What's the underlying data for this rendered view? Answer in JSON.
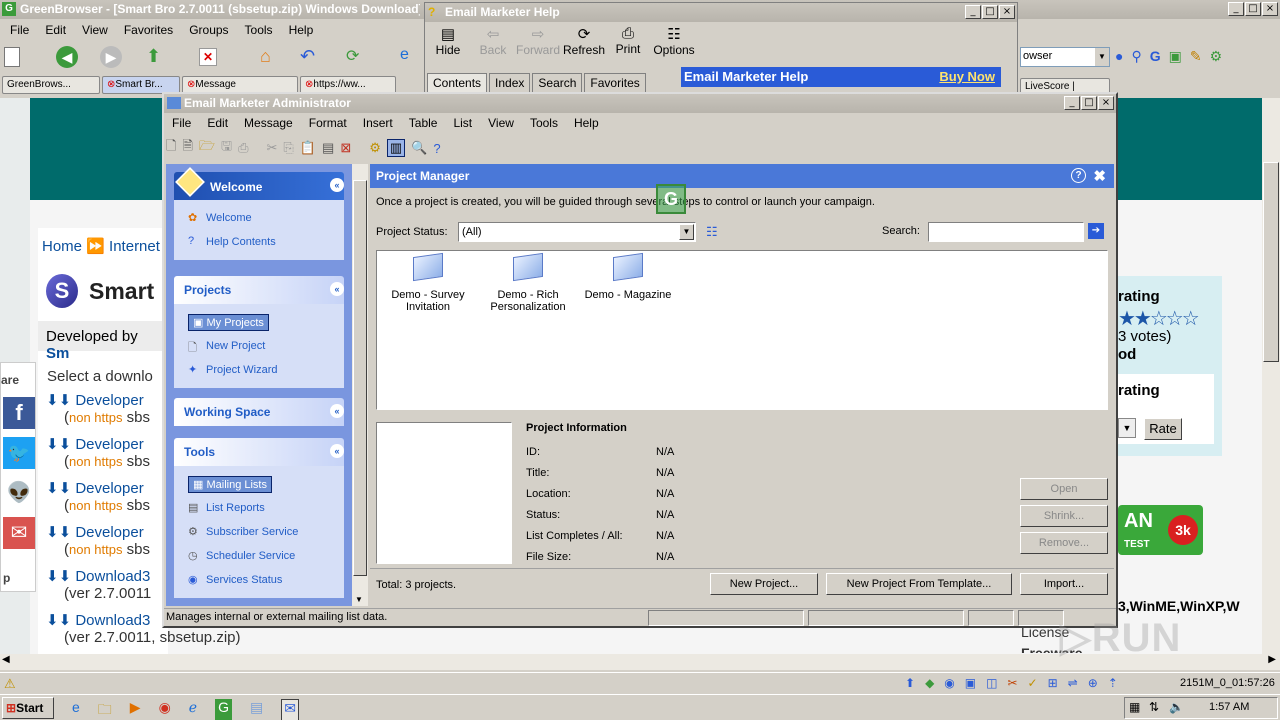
{
  "browser": {
    "title": "GreenBrowser - [Smart Bro 2.7.0011 (sbsetup.zip) Windows Download]",
    "menu": [
      "File",
      "Edit",
      "View",
      "Favorites",
      "Groups",
      "Tools",
      "Help"
    ],
    "address_text": "owser",
    "tabs": [
      "GreenBrows...",
      "Smart Br...",
      "Message",
      "https://ww...",
      "LiveScore |"
    ],
    "breadcrumb_home": "Home",
    "breadcrumb_internet": "Internet",
    "page_title": "Smart",
    "developed_by": "Developed by",
    "developed_link": "Sm",
    "share": "are",
    "select_download": "Select a downlo",
    "downloads": [
      {
        "label": "Developer",
        "sub1": "non https",
        "sub2": "sbs"
      },
      {
        "label": "Developer",
        "sub1": "non https",
        "sub2": "sbs"
      },
      {
        "label": "Developer",
        "sub1": "non https",
        "sub2": "sbs"
      },
      {
        "label": "Developer",
        "sub1": "non https",
        "sub2": "sbs"
      },
      {
        "label": "Download3",
        "sub1": "",
        "sub2": "(ver 2.7.0011"
      },
      {
        "label": "Download3",
        "sub1": "",
        "sub2": "(ver 2.7.0011, sbsetup.zip)"
      }
    ],
    "rating_title1": "rating",
    "votes": "3 votes)",
    "rating_od": "od",
    "rating_title2": "rating",
    "rate_button": "Rate",
    "badge_an": "AN",
    "badge_test": "TEST",
    "badge_3k": "3k",
    "os_text": "3,WinME,WinXP,W",
    "license": "License",
    "freeware": "Freeware"
  },
  "help_window": {
    "title": "Email Marketer Help",
    "toolbar": [
      "Hide",
      "Back",
      "Forward",
      "Refresh",
      "Print",
      "Options"
    ],
    "tabs": [
      "Contents",
      "Index",
      "Search",
      "Favorites"
    ],
    "banner_title": "Email Marketer Help",
    "buy_now": "Buy Now"
  },
  "app": {
    "title": "Email Marketer Administrator",
    "menu": [
      "File",
      "Edit",
      "Message",
      "Format",
      "Insert",
      "Table",
      "List",
      "View",
      "Tools",
      "Help"
    ],
    "sidebar": {
      "welcome_head": "Welcome",
      "welcome_items": [
        "Welcome",
        "Help Contents"
      ],
      "projects_head": "Projects",
      "projects_items": [
        "My Projects",
        "New Project",
        "Project Wizard"
      ],
      "workspace_head": "Working Space",
      "tools_head": "Tools",
      "tools_items": [
        "Mailing Lists",
        "List Reports",
        "Subscriber Service",
        "Scheduler Service",
        "Services Status"
      ]
    },
    "pm": {
      "title": "Project Manager",
      "intro": "Once a project is created, you will be guided through several steps to control or launch your campaign.",
      "status_label": "Project Status:",
      "status_value": "(All)",
      "search_label": "Search:",
      "search_value": "",
      "projects": [
        {
          "line1": "Demo - Survey",
          "line2": "Invitation"
        },
        {
          "line1": "Demo - Rich",
          "line2": "Personalization"
        },
        {
          "line1": "Demo - Magazine",
          "line2": ""
        }
      ],
      "info_title": "Project Information",
      "info": [
        {
          "k": "ID:",
          "v": "N/A"
        },
        {
          "k": "Title:",
          "v": "N/A"
        },
        {
          "k": "Location:",
          "v": "N/A"
        },
        {
          "k": "Status:",
          "v": "N/A"
        },
        {
          "k": "List Completes / All:",
          "v": "N/A"
        },
        {
          "k": "File Size:",
          "v": "N/A"
        }
      ],
      "btn_open": "Open",
      "btn_shrink": "Shrink...",
      "btn_remove": "Remove...",
      "total": "Total: 3 projects.",
      "btn_new": "New Project...",
      "btn_template": "New Project From Template...",
      "btn_import": "Import..."
    },
    "status": "Manages internal or external mailing list data."
  },
  "statusbar_right": "2151M_0_01:57:26",
  "taskbar": {
    "start": "Start",
    "time": "1:57 AM"
  },
  "colors": {
    "app_title_blue": "#0a246a",
    "panel_blue": "#215dc6",
    "pm_header": "#4a78d8",
    "browser_teal": "#006b6b"
  }
}
